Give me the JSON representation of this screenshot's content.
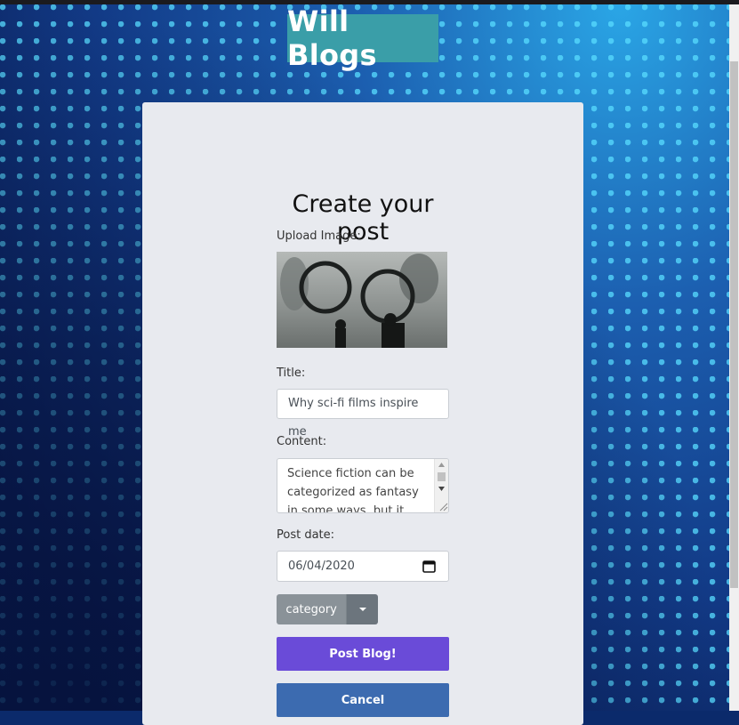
{
  "header": {
    "logo_text": "Will Blogs"
  },
  "form": {
    "heading": "Create your post",
    "upload_label": "Upload Image:",
    "title_label": "Title:",
    "title_value": "Why sci-fi films inspire me",
    "content_label": "Content:",
    "content_value": "Science fiction can be categorized as fantasy in some ways, but it",
    "date_label": "Post date:",
    "date_value": "06/04/2020",
    "category_label": "category",
    "post_button": "Post Blog!",
    "cancel_button": "Cancel"
  },
  "colors": {
    "logo_bg": "#3a9ea8",
    "post_button_bg": "#6a4bd8",
    "cancel_button_bg": "#3c6bb0",
    "category_bg": "#8a9298",
    "card_bg": "#e8eaef"
  },
  "icons": [
    "calendar-icon",
    "caret-down-icon",
    "scroll-up-icon",
    "scroll-down-icon",
    "resize-grip-icon"
  ]
}
